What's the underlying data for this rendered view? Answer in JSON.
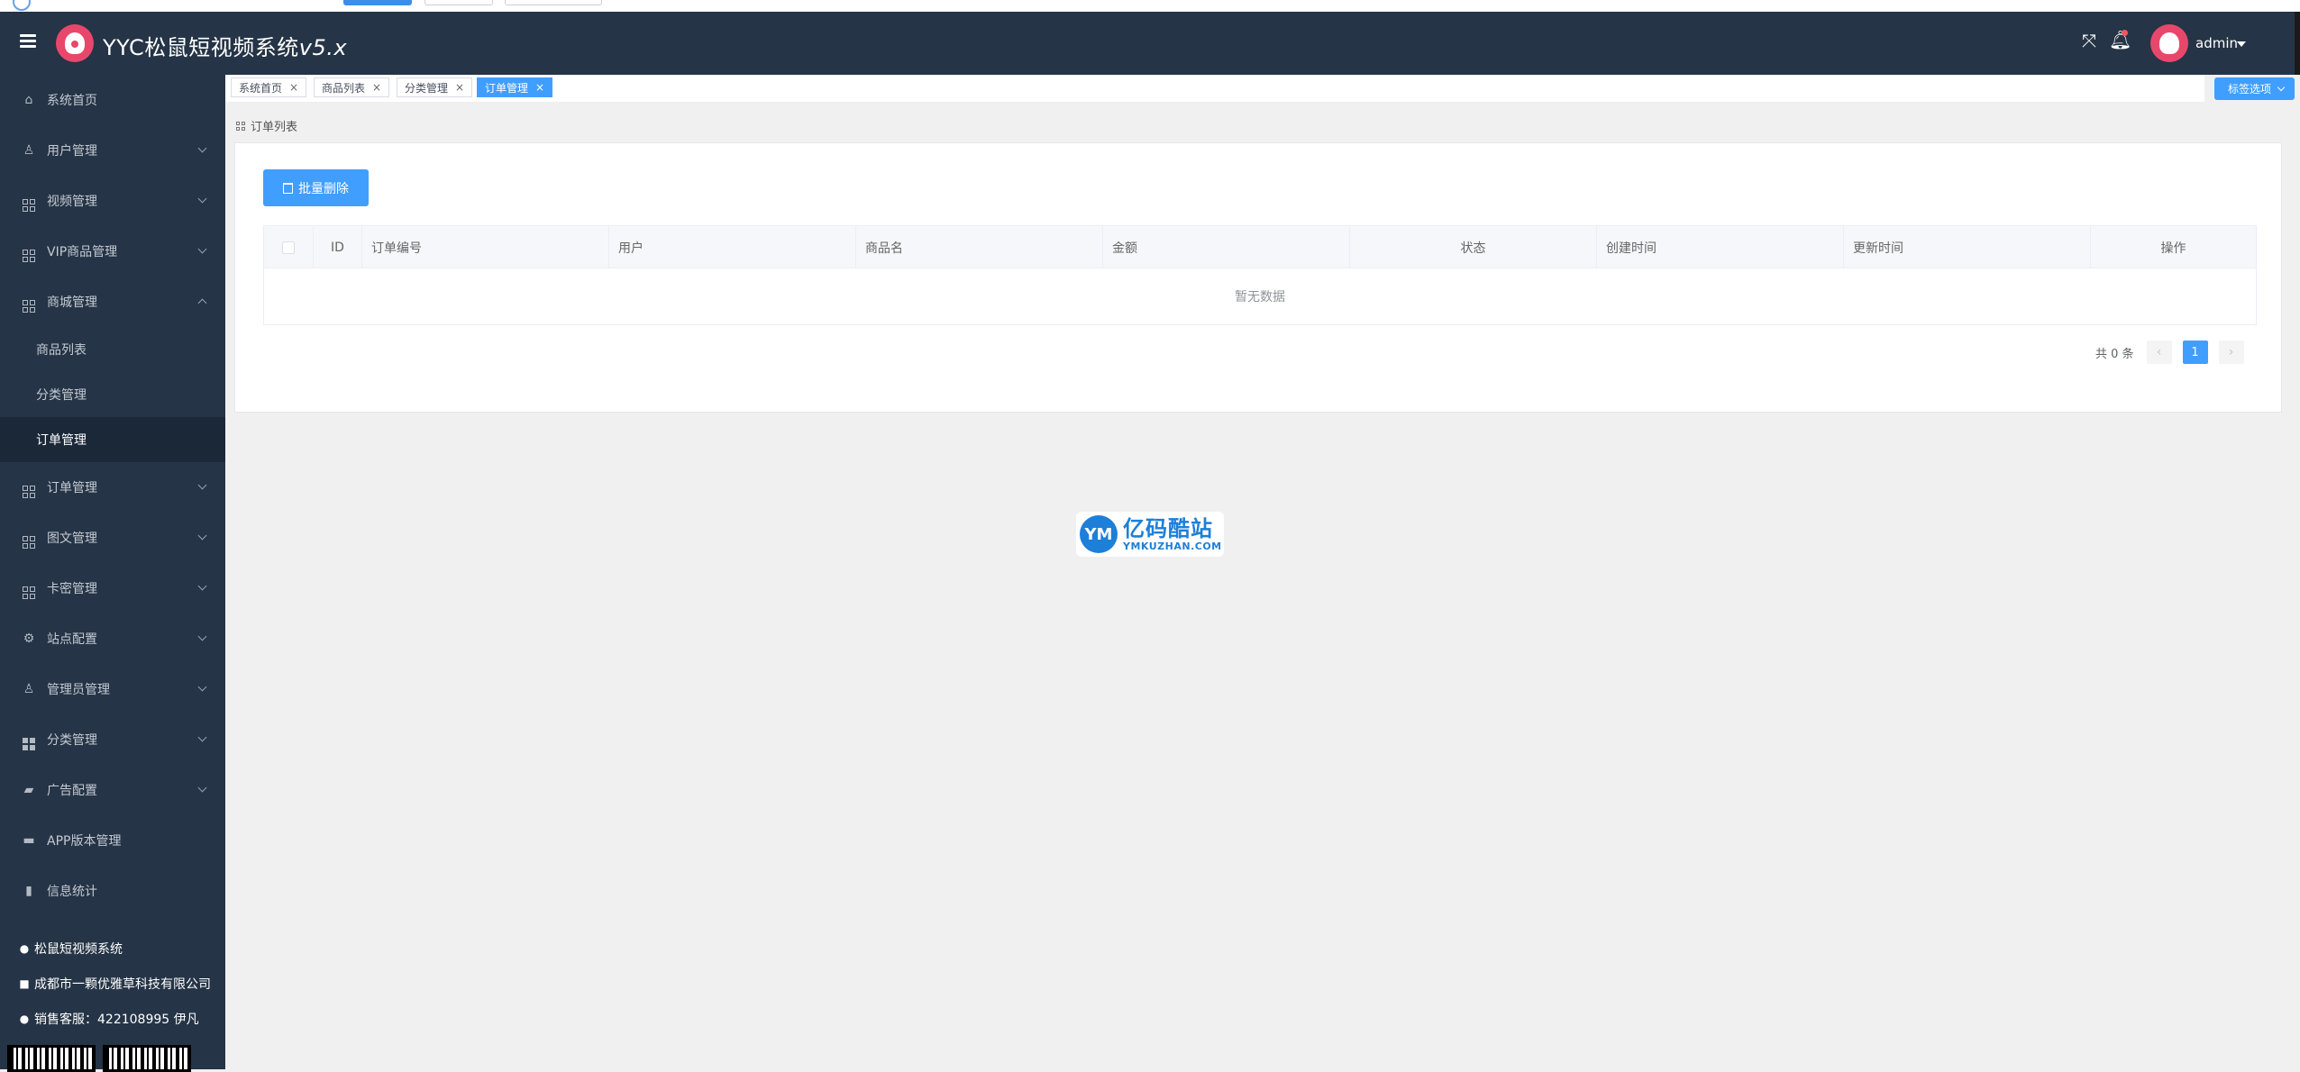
{
  "header": {
    "title_main": "YYC松鼠短视频系统",
    "title_version": "v5.x",
    "user_name": "admin"
  },
  "sidebar": {
    "items": [
      {
        "label": "系统首页",
        "icon": "home-icon"
      },
      {
        "label": "用户管理",
        "icon": "user-icon"
      },
      {
        "label": "视频管理",
        "icon": "grid-icon"
      },
      {
        "label": "VIP商品管理",
        "icon": "grid-icon"
      },
      {
        "label": "商城管理",
        "icon": "grid-icon"
      },
      {
        "label": "订单管理",
        "icon": "grid-icon"
      },
      {
        "label": "图文管理",
        "icon": "grid-icon"
      },
      {
        "label": "卡密管理",
        "icon": "grid-icon"
      },
      {
        "label": "站点配置",
        "icon": "gear-icon"
      },
      {
        "label": "管理员管理",
        "icon": "admin-user-icon"
      },
      {
        "label": "分类管理",
        "icon": "grid-solid-icon"
      },
      {
        "label": "广告配置",
        "icon": "bag-icon"
      },
      {
        "label": "APP版本管理",
        "icon": "briefcase-icon"
      },
      {
        "label": "信息统计",
        "icon": "bar-chart-icon"
      }
    ],
    "mall_submenu": [
      {
        "label": "商品列表"
      },
      {
        "label": "分类管理"
      },
      {
        "label": "订单管理"
      }
    ],
    "footer": {
      "system_name": "松鼠短视频系统",
      "company": "成都市一颗优雅草科技有限公司",
      "sales_contact": "销售客服：422108995 伊凡"
    }
  },
  "tabs": [
    {
      "label": "系统首页"
    },
    {
      "label": "商品列表"
    },
    {
      "label": "分类管理"
    },
    {
      "label": "订单管理"
    }
  ],
  "tab_options_label": "标签选项",
  "page": {
    "title": "订单列表",
    "batch_delete_label": "批量删除",
    "table": {
      "columns": [
        "ID",
        "订单编号",
        "用户",
        "商品名",
        "金额",
        "状态",
        "创建时间",
        "更新时间",
        "操作"
      ],
      "rows": [],
      "empty_text": "暂无数据"
    },
    "pagination": {
      "total_text": "共 0 条",
      "current_page": "1",
      "prev": "‹",
      "next": "›"
    }
  },
  "watermark": {
    "logo_text": "YM",
    "cn": "亿码酷站",
    "en": "YMKUZHAN.COM"
  },
  "colors": {
    "header_bg": "#253446",
    "sidebar_bg": "#253446",
    "sidebar_active_bg": "#1b2838",
    "accent": "#409eff",
    "page_bg": "#f0f0f0"
  }
}
